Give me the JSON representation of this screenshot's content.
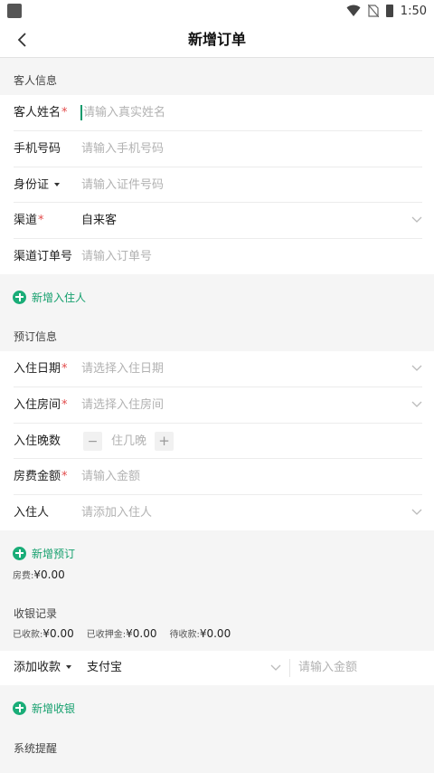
{
  "status_bar": {
    "time": "1:50",
    "icons": [
      "app-icon",
      "wifi-icon",
      "no-sim-icon",
      "battery-icon"
    ]
  },
  "header": {
    "title": "新增订单",
    "back_icon": "chevron-left-icon"
  },
  "guest_section": {
    "title": "客人信息",
    "fields": {
      "name": {
        "label": "客人姓名",
        "required": "*",
        "placeholder": "请输入真实姓名"
      },
      "phone": {
        "label": "手机号码",
        "placeholder": "请输入手机号码"
      },
      "id_type": {
        "label": "身份证",
        "placeholder": "请输入证件号码"
      },
      "channel": {
        "label": "渠道",
        "required": "*",
        "value": "自来客"
      },
      "channel_order": {
        "label": "渠道订单号",
        "placeholder": "请输入订单号"
      }
    },
    "add_guest": "新增入住人"
  },
  "booking_section": {
    "title": "预订信息",
    "fields": {
      "checkin_date": {
        "label": "入住日期",
        "required": "*",
        "placeholder": "请选择入住日期"
      },
      "room": {
        "label": "入住房间",
        "required": "*",
        "placeholder": "请选择入住房间"
      },
      "nights": {
        "label": "入住晚数",
        "placeholder": "住几晚",
        "minus": "−",
        "plus": "+"
      },
      "amount": {
        "label": "房费金额",
        "required": "*",
        "placeholder": "请输入金额"
      },
      "occupant": {
        "label": "入住人",
        "placeholder": "请添加入住人"
      }
    },
    "add_booking": "新增预订",
    "room_fee_label": "房费:",
    "room_fee_value": "¥0.00"
  },
  "cashier_section": {
    "title": "收银记录",
    "received_label": "已收款:",
    "received_value": "¥0.00",
    "deposit_label": "已收押金:",
    "deposit_value": "¥0.00",
    "pending_label": "待收款:",
    "pending_value": "¥0.00",
    "add_payment_label": "添加收款",
    "payment_method": "支付宝",
    "amount_placeholder": "请输入金额",
    "add_cashier": "新增收银"
  },
  "reminder_section": {
    "title": "系统提醒"
  },
  "colors": {
    "accent": "#1aad78",
    "required": "#e24b4b",
    "placeholder": "#b2b2b2",
    "background": "#f5f5f5"
  }
}
